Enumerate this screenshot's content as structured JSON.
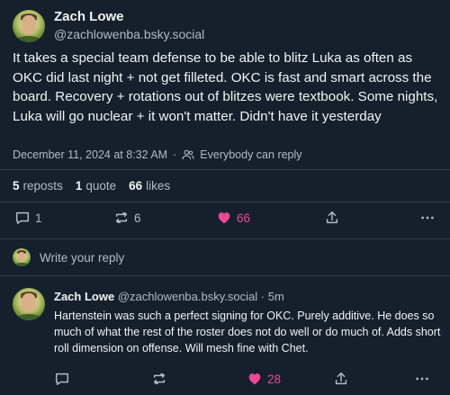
{
  "post": {
    "author_name": "Zach Lowe",
    "author_handle": "@zachlowenba.bsky.social",
    "text": "It takes a special team defense to be able to blitz Luka as often as OKC did last night + not get filleted. OKC is fast and smart across the board. Recovery + rotations out of blitzes were textbook. Some nights, Luka will go nuclear + it won't matter. Didn't have it yesterday",
    "timestamp": "December 11, 2024 at 8:32 AM",
    "audience": "Everybody can reply"
  },
  "stats": {
    "reposts_count": "5",
    "reposts_label": "reposts",
    "quotes_count": "1",
    "quotes_label": "quote",
    "likes_count": "66",
    "likes_label": "likes"
  },
  "actions": {
    "reply_count": "1",
    "repost_count": "6",
    "like_count": "66"
  },
  "composer": {
    "placeholder": "Write your reply"
  },
  "reply": {
    "author_name": "Zach Lowe",
    "author_handle": "@zachlowenba.bsky.social",
    "separator": "·",
    "time": "5m",
    "text": "Hartenstein was such a perfect signing for OKC. Purely additive. He does so much of what the rest of the roster does not do well or do much of. Adds short roll dimension on offense. Will mesh fine with Chet.",
    "reply_count": "",
    "repost_count": "",
    "like_count": "28"
  },
  "colors": {
    "background": "#16202c",
    "text_primary": "#f1f3f5",
    "text_secondary": "#aebbc9",
    "like_accent": "#ec4899",
    "divider": "#2e3c4c"
  },
  "icons": [
    "reply-icon",
    "repost-icon",
    "heart-icon",
    "share-icon",
    "more-icon",
    "people-icon"
  ]
}
